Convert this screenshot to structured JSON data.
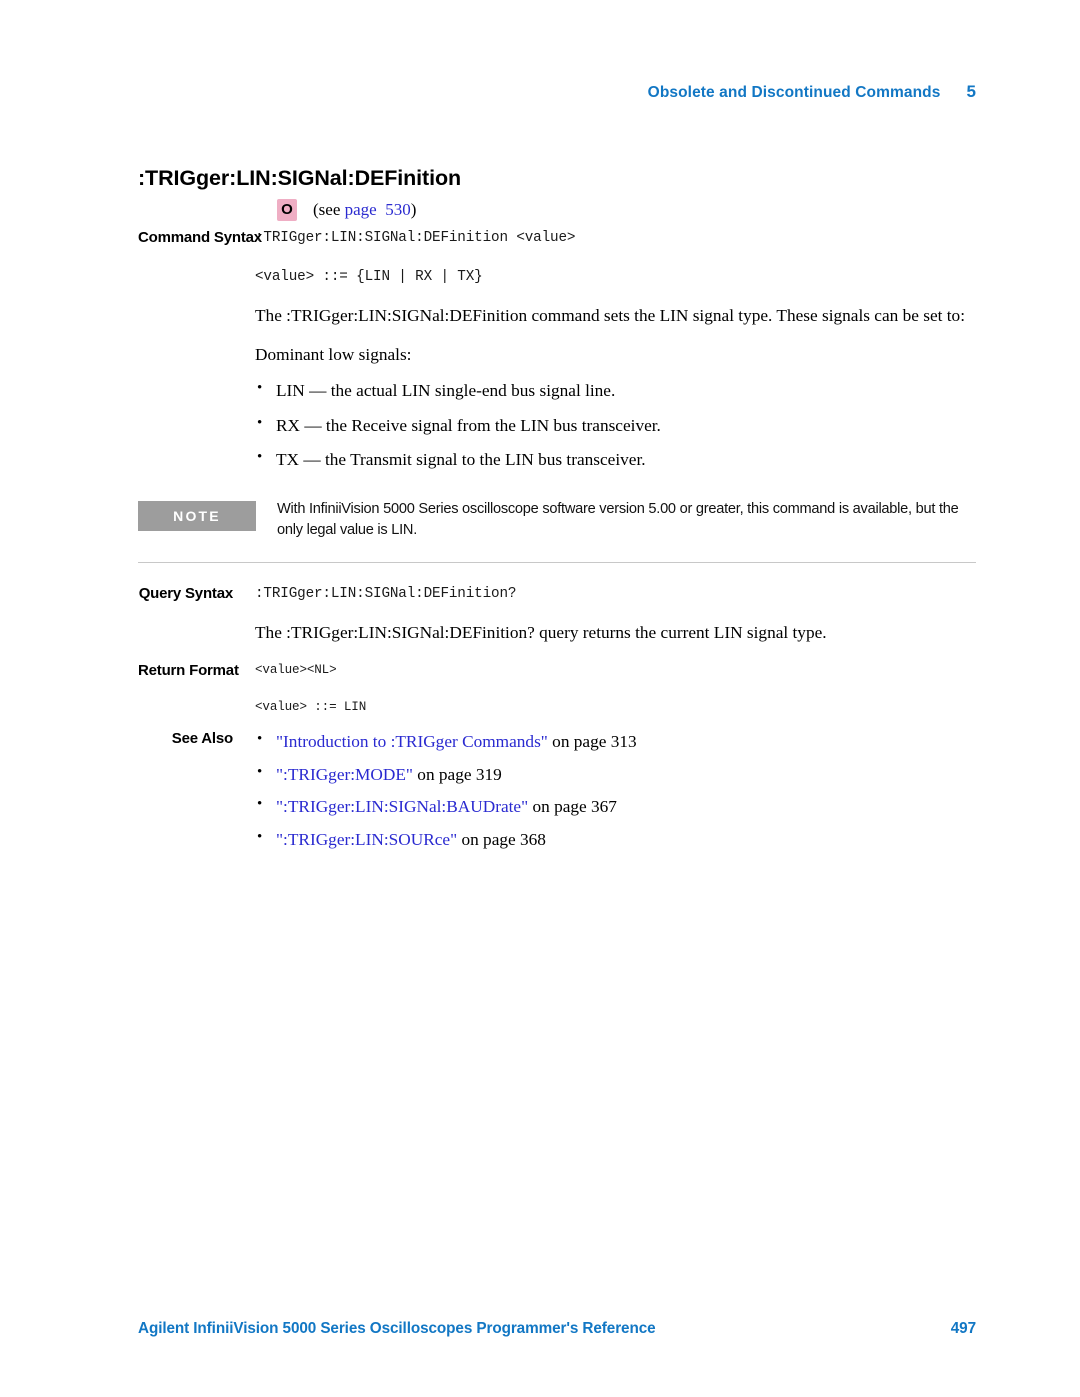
{
  "header": {
    "chapter_title": "Obsolete and Discontinued Commands",
    "chapter_number": "5"
  },
  "command": {
    "title": ":TRIGger:LIN:SIGNal:DEFinition",
    "obsolete_badge": "O",
    "see_prefix": "(see ",
    "see_link": "page  530",
    "see_suffix": ")"
  },
  "sections": {
    "command_syntax": {
      "label": "Command Syntax",
      "line1": ":TRIGger:LIN:SIGNal:DEFinition <value>",
      "line2": "<value> ::= {LIN | RX | TX}"
    },
    "description": {
      "paragraph1": "The :TRIGger:LIN:SIGNal:DEFinition command sets the LIN signal type. These signals can be set to:",
      "paragraph2": "Dominant low signals:",
      "bullets": [
        "LIN — the actual LIN single-end bus signal line.",
        "RX — the Receive signal from the LIN bus transceiver.",
        "TX — the Transmit signal to the LIN bus transceiver."
      ]
    },
    "note": {
      "tag": "NOTE",
      "text": "With InfiniiVision 5000 Series oscilloscope software version 5.00 or greater, this command is available, but the only legal value is LIN."
    },
    "query_syntax": {
      "label": "Query Syntax",
      "line1": ":TRIGger:LIN:SIGNal:DEFinition?",
      "paragraph": "The :TRIGger:LIN:SIGNal:DEFinition? query returns the current LIN signal type."
    },
    "return_format": {
      "label": "Return Format",
      "line1": "<value><NL>",
      "line2": "<value> ::= LIN"
    },
    "see_also": {
      "label": "See Also",
      "items": [
        {
          "link": "\"Introduction to :TRIGger Commands\"",
          "tail": " on page  313"
        },
        {
          "link": "\":TRIGger:MODE\"",
          "tail": " on page  319"
        },
        {
          "link": "\":TRIGger:LIN:SIGNal:BAUDrate\"",
          "tail": " on page  367"
        },
        {
          "link": "\":TRIGger:LIN:SOURce\"",
          "tail": " on page  368"
        }
      ]
    }
  },
  "footer": {
    "book_title": "Agilent InfiniiVision 5000 Series Oscilloscopes Programmer's Reference",
    "page_number": "497"
  },
  "colors": {
    "accent_blue": "#1277c4",
    "link_blue": "#2a2ad0",
    "note_gray": "#9d9d9d",
    "badge_pink": "#efaec4"
  }
}
